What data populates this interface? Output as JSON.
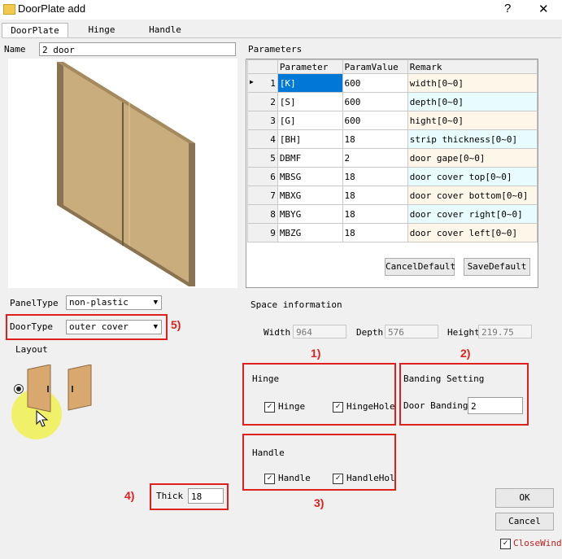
{
  "window": {
    "title": "DoorPlate add",
    "help_icon": "?",
    "close_icon": "✕"
  },
  "tabs": [
    "DoorPlate",
    "Hinge",
    "Handle"
  ],
  "name_field": {
    "label": "Name",
    "value": "2 door"
  },
  "params": {
    "title": "Parameters",
    "headers": [
      "Parameter",
      "ParamValue",
      "Remark"
    ],
    "rows": [
      {
        "idx": "1",
        "param": "[K]",
        "value": "600",
        "remark": "width[0~0]"
      },
      {
        "idx": "2",
        "param": "[S]",
        "value": "600",
        "remark": "depth[0~0]"
      },
      {
        "idx": "3",
        "param": "[G]",
        "value": "600",
        "remark": "hight[0~0]"
      },
      {
        "idx": "4",
        "param": "[BH]",
        "value": "18",
        "remark": "strip thickness[0~0]"
      },
      {
        "idx": "5",
        "param": "DBMF",
        "value": "2",
        "remark": "door gape[0~0]"
      },
      {
        "idx": "6",
        "param": "MBSG",
        "value": "18",
        "remark": "door cover top[0~0]"
      },
      {
        "idx": "7",
        "param": "MBXG",
        "value": "18",
        "remark": "door cover bottom[0~0]"
      },
      {
        "idx": "8",
        "param": "MBYG",
        "value": "18",
        "remark": "door cover right[0~0]"
      },
      {
        "idx": "9",
        "param": "MBZG",
        "value": "18",
        "remark": "door cover left[0~0]"
      }
    ],
    "cancel_default": "CancelDefault",
    "save_default": "SaveDefault"
  },
  "panel_type": {
    "label": "PanelType",
    "value": "non-plastic"
  },
  "door_type": {
    "label": "DoorType",
    "value": "outer cover"
  },
  "layout_label": "Layout",
  "space": {
    "title": "Space information",
    "width_label": "Width",
    "width": "964",
    "depth_label": "Depth",
    "depth": "576",
    "height_label": "Height",
    "height": "219.75"
  },
  "hinge": {
    "title": "Hinge",
    "hinge_label": "Hinge",
    "hingehole_label": "HingeHole"
  },
  "banding": {
    "title": "Banding Setting",
    "label": "Door Banding",
    "value": "2"
  },
  "handle": {
    "title": "Handle",
    "handle_label": "Handle",
    "handlehole_label": "HandleHol"
  },
  "thick": {
    "label": "Thick",
    "value": "18"
  },
  "buttons": {
    "ok": "OK",
    "cancel": "Cancel",
    "close_window": "CloseWindo"
  },
  "annotations": {
    "a1": "1)",
    "a2": "2)",
    "a3": "3)",
    "a4": "4)",
    "a5": "5)"
  },
  "colors": {
    "highlight": "#e0201c",
    "selection": "#0078d7",
    "cursor_glow": "#f0f03c"
  }
}
